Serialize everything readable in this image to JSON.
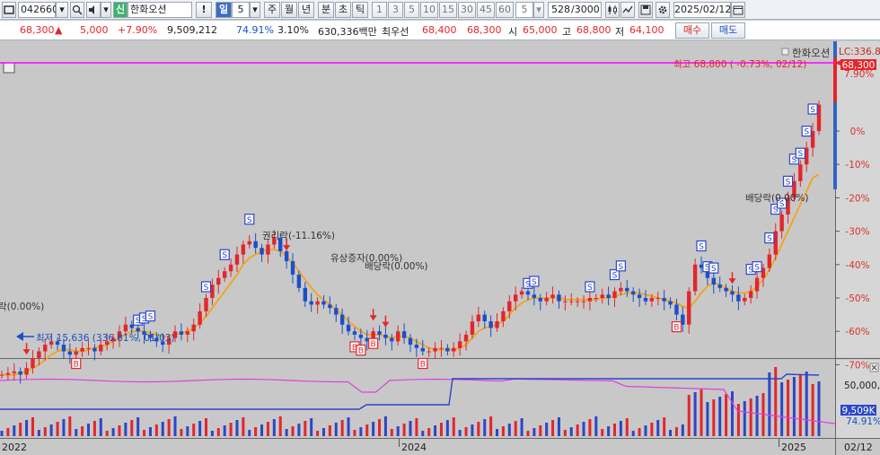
{
  "toolbar": {
    "code": "042660",
    "badge": "신",
    "name": "한화오션",
    "alert": "!",
    "period_selected": "일",
    "period_count": "5",
    "periods": [
      "주",
      "월",
      "년",
      "분",
      "초",
      "틱"
    ],
    "intervals": [
      "1",
      "3",
      "5",
      "10",
      "15",
      "30",
      "45",
      "60"
    ],
    "interval_count": "5",
    "data_count": "528",
    "data_max": "/3000",
    "date": "2025/02/12"
  },
  "quote": {
    "price": "68,300",
    "arrow": "▲",
    "change": "5,000",
    "change_pct": "+7.90%",
    "volume": "9,509,212",
    "vol_ratio": "74.91%",
    "turnover": "3.10%",
    "amount": "630,336백만",
    "best_label": "최우선",
    "best_ask": "68,400",
    "best_bid": "68,300",
    "open_label": "시",
    "open": "65,000",
    "high_label": "고",
    "high": "68,800",
    "low_label": "저",
    "low": "64,100",
    "buy_label": "매수",
    "sell_label": "매도"
  },
  "chart_data": {
    "type": "candlestick",
    "title": "한화오션",
    "y_axis_right": [
      "LC:336.8",
      "7.90%",
      "0%",
      "-10%",
      "-20%",
      "-30%",
      "-40%",
      "-50%",
      "-60%",
      "-70%"
    ],
    "y_range": [
      "-75%",
      "8%"
    ],
    "last_price_tag": "68,300",
    "max_label": "최고 68,800 ( -0.73%, 02/12)",
    "min_label": "최저 15,636 (336.81%, 01/03)",
    "x_labels": [
      "2022",
      "2024",
      "2025",
      "02/12"
    ],
    "moving_average": {
      "label": "MA",
      "color": "#f5a314"
    },
    "close_pct_series": [
      -73,
      -72.5,
      -72,
      -73,
      -71,
      -68,
      -66,
      -64,
      -63,
      -64,
      -66,
      -67,
      -66,
      -65,
      -65,
      -66,
      -64,
      -63,
      -62,
      -60,
      -58,
      -59,
      -60,
      -61,
      -62,
      -63,
      -64,
      -62,
      -60,
      -61,
      -60,
      -58,
      -54,
      -50,
      -46,
      -44,
      -42,
      -40,
      -37,
      -34,
      -33,
      -35,
      -37,
      -34,
      -32,
      -36,
      -39,
      -43,
      -47,
      -51,
      -52,
      -51,
      -52,
      -53,
      -55,
      -58,
      -60,
      -61,
      -62,
      -63,
      -60,
      -61,
      -62,
      -63,
      -60,
      -62,
      -64,
      -65,
      -66,
      -66,
      -65,
      -65,
      -66,
      -65,
      -63,
      -61,
      -57,
      -55,
      -57,
      -59,
      -57,
      -54,
      -51,
      -49,
      -48,
      -49,
      -50,
      -51,
      -50,
      -49,
      -51,
      -51,
      -51,
      -51,
      -51,
      -50,
      -50,
      -49,
      -50,
      -48,
      -47,
      -48,
      -49,
      -50,
      -51,
      -50,
      -50,
      -51,
      -52,
      -55,
      -58,
      -48,
      -40,
      -41,
      -44,
      -46,
      -47,
      -48,
      -49,
      -51,
      -50,
      -48,
      -44,
      -41,
      -37,
      -30,
      -25,
      -20,
      -15,
      -10,
      -5,
      0,
      7.9
    ],
    "ma_pct_series": [
      -73,
      -73,
      -73,
      -72.5,
      -72,
      -71,
      -70,
      -68.5,
      -67,
      -66,
      -65.5,
      -65.5,
      -66,
      -66,
      -65.5,
      -65,
      -64.5,
      -64,
      -63,
      -62,
      -61,
      -60,
      -60,
      -60,
      -60.5,
      -61,
      -61.5,
      -61.5,
      -61,
      -60.5,
      -60,
      -59,
      -57.5,
      -55.5,
      -53,
      -50.5,
      -48,
      -45.5,
      -43,
      -40,
      -38,
      -37,
      -36,
      -35.5,
      -35.5,
      -36,
      -37.5,
      -39.5,
      -42,
      -44.5,
      -47,
      -49,
      -50.5,
      -52,
      -53.5,
      -55,
      -57,
      -58.5,
      -60,
      -61,
      -61,
      -61,
      -61.5,
      -62,
      -61.5,
      -61.5,
      -62,
      -63,
      -64,
      -65,
      -65.5,
      -65.5,
      -65.5,
      -65.5,
      -65,
      -64,
      -62,
      -60,
      -59,
      -58.5,
      -58,
      -57,
      -55,
      -53,
      -51.5,
      -50.5,
      -50,
      -50,
      -50,
      -50,
      -50,
      -50.5,
      -50.5,
      -50.5,
      -50.5,
      -50.5,
      -50.5,
      -50,
      -50,
      -49.5,
      -49,
      -48.5,
      -48.5,
      -48.5,
      -49,
      -49.5,
      -50,
      -50.5,
      -51,
      -51.5,
      -52.5,
      -53,
      -51,
      -48.5,
      -46.5,
      -45.5,
      -46,
      -47,
      -48,
      -48.5,
      -48.5,
      -48,
      -46.5,
      -44.5,
      -41.5,
      -38,
      -34,
      -30,
      -26,
      -22,
      -18,
      -14,
      -13
    ],
    "annotations": [
      "락(0.00%)",
      "권리락(-11.16%)",
      "유상증자(0.00%)",
      "배당락(0.00%)",
      "배당락(0.00%)"
    ],
    "markers": {
      "sell": "S",
      "buy": "B"
    },
    "volume_panel": {
      "right_labels": [
        "50,000,0",
        "9,509K",
        "74.91%"
      ],
      "series": [
        {
          "name": "turnover",
          "color": "#e040e0"
        },
        {
          "name": "shares",
          "color": "#2c46c8"
        },
        {
          "name": "volume",
          "color": "#2c46c8"
        }
      ]
    }
  }
}
